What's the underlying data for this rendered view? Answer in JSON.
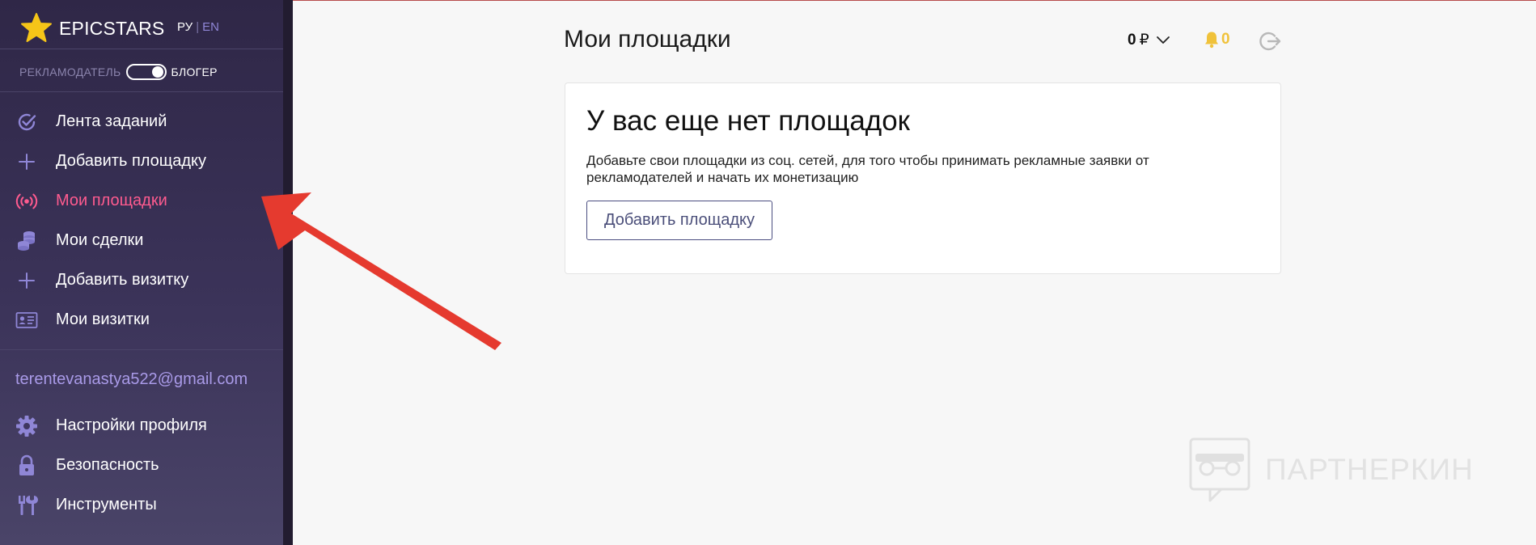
{
  "brand": {
    "name": "EPICSTARS"
  },
  "lang": {
    "active": "РУ",
    "separator": "|",
    "inactive": "EN"
  },
  "role": {
    "left": "РЕКЛАМОДАТЕЛЬ",
    "right": "БЛОГЕР",
    "selected": "БЛОГЕР"
  },
  "menu": {
    "items": [
      {
        "label": "Лента заданий",
        "icon": "check-circle-icon"
      },
      {
        "label": "Добавить площадку",
        "icon": "plus-icon"
      },
      {
        "label": "Мои площадки",
        "icon": "broadcast-icon",
        "active": true
      },
      {
        "label": "Мои сделки",
        "icon": "coins-icon"
      },
      {
        "label": "Добавить визитку",
        "icon": "plus-icon"
      },
      {
        "label": "Мои визитки",
        "icon": "id-card-icon"
      }
    ]
  },
  "user": {
    "email": "terentevanastya522@gmail.com"
  },
  "menu2": {
    "items": [
      {
        "label": "Настройки профиля",
        "icon": "gear-icon"
      },
      {
        "label": "Безопасность",
        "icon": "lock-icon"
      },
      {
        "label": "Инструменты",
        "icon": "tools-icon"
      }
    ]
  },
  "header": {
    "title": "Мои площадки",
    "balance": "0",
    "currency": "₽",
    "notifications": "0"
  },
  "empty": {
    "title": "У вас еще нет площадок",
    "text": "Добавьте свои площадки из соц. сетей, для того чтобы принимать рекламные заявки от рекламодателей и начать их монетизацию",
    "button": "Добавить площадку"
  },
  "watermark": {
    "text": "ПАРТНЕРКИН"
  },
  "colors": {
    "sidebar_bg": "#3b3359",
    "active_item": "#ff5b8f",
    "icon_purple": "#8f86d6",
    "email": "#a99ae8",
    "bell": "#f0c23a",
    "arrow": "#e53a2f"
  }
}
